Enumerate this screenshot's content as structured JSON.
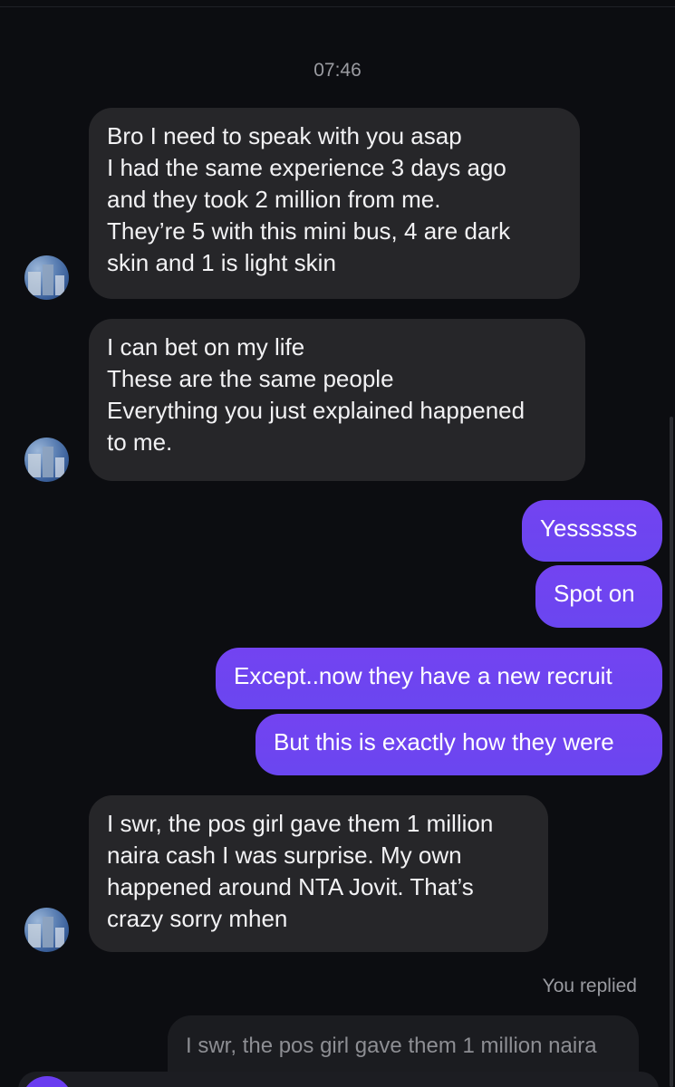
{
  "colors": {
    "background": "#0c0d11",
    "incoming_bubble": "#262629",
    "outgoing_bubble": "#7343f1",
    "muted_text": "#9a9ba1"
  },
  "conversation": {
    "timestamp": "07:46",
    "messages": [
      {
        "direction": "incoming",
        "lines": [
          "Bro I need to speak with you asap",
          "I had the same experience 3 days ago",
          "and they took 2 million from me.",
          "They’re 5 with this mini bus,  4 are dark",
          "skin and 1 is light skin"
        ]
      },
      {
        "direction": "incoming",
        "lines": [
          "I can bet on my life",
          "These are the same people",
          "Everything you just explained happened",
          "to me."
        ]
      },
      {
        "direction": "outgoing",
        "lines": [
          "Yessssss"
        ]
      },
      {
        "direction": "outgoing",
        "lines": [
          "Spot on"
        ]
      },
      {
        "direction": "outgoing",
        "lines": [
          "Except..now they have a new recruit"
        ]
      },
      {
        "direction": "outgoing",
        "lines": [
          "But this is exactly how they were"
        ]
      },
      {
        "direction": "incoming",
        "lines": [
          "I swr, the pos girl gave them 1 million",
          "naira cash I was surprise. My own",
          "happened around NTA Jovit. That’s",
          "crazy sorry mhen"
        ]
      }
    ],
    "replied_label": "You replied",
    "reply_preview": "I swr, the pos girl gave them 1 million naira"
  }
}
